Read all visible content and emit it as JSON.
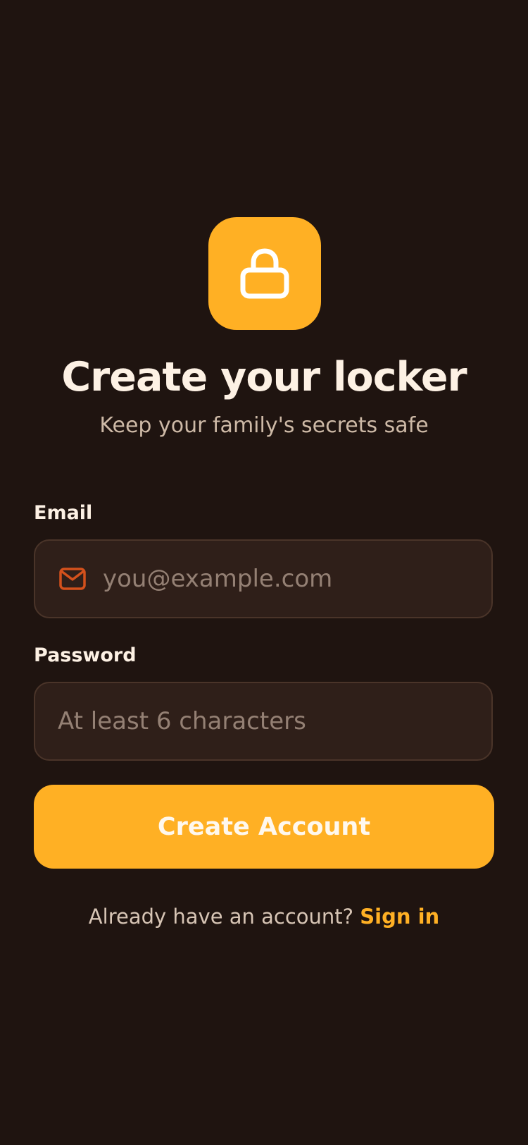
{
  "app": {
    "icon": "lock-icon"
  },
  "header": {
    "title": "Create your locker",
    "subtitle": "Keep your family's secrets safe"
  },
  "form": {
    "email": {
      "label": "Email",
      "placeholder": "you@example.com",
      "value": "",
      "icon": "mail-icon"
    },
    "password": {
      "label": "Password",
      "placeholder": "At least 6 characters",
      "value": ""
    },
    "submit_label": "Create Account"
  },
  "footer": {
    "prompt": "Already have an account?",
    "link_label": "Sign in"
  },
  "colors": {
    "background": "#1f1410",
    "accent": "#ffb024",
    "input_background": "#2f1f19",
    "icon_accent": "#d4511c"
  }
}
